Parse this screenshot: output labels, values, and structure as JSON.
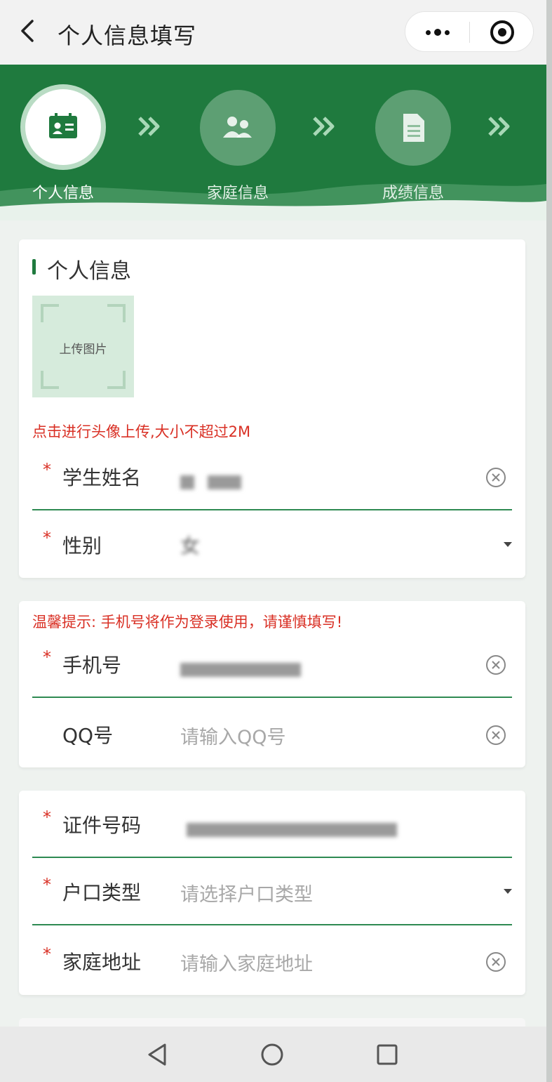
{
  "app": {
    "title": "个人信息填写"
  },
  "steps": [
    {
      "label": "个人信息",
      "icon": "id-card-icon",
      "active": true
    },
    {
      "label": "家庭信息",
      "icon": "family-icon",
      "active": false
    },
    {
      "label": "成绩信息",
      "icon": "document-icon",
      "active": false
    }
  ],
  "personal": {
    "section_title": "个人信息",
    "upload_text": "上传图片",
    "upload_hint": "点击进行头像上传,大小不超过2M",
    "name_label": "学生姓名",
    "gender_label": "性别",
    "gender_value": "女"
  },
  "contact": {
    "tip": "温馨提示: 手机号将作为登录使用，请谨慎填写!",
    "phone_label": "手机号",
    "qq_label": "QQ号",
    "qq_placeholder": "请输入QQ号"
  },
  "identity": {
    "id_label": "证件号码",
    "hukou_label": "户口类型",
    "hukou_placeholder": "请选择户口类型",
    "address_label": "家庭地址",
    "address_placeholder": "请输入家庭地址"
  },
  "required_mark": "*",
  "colors": {
    "primary_green": "#1f7a3e",
    "error_red": "#d93025"
  }
}
